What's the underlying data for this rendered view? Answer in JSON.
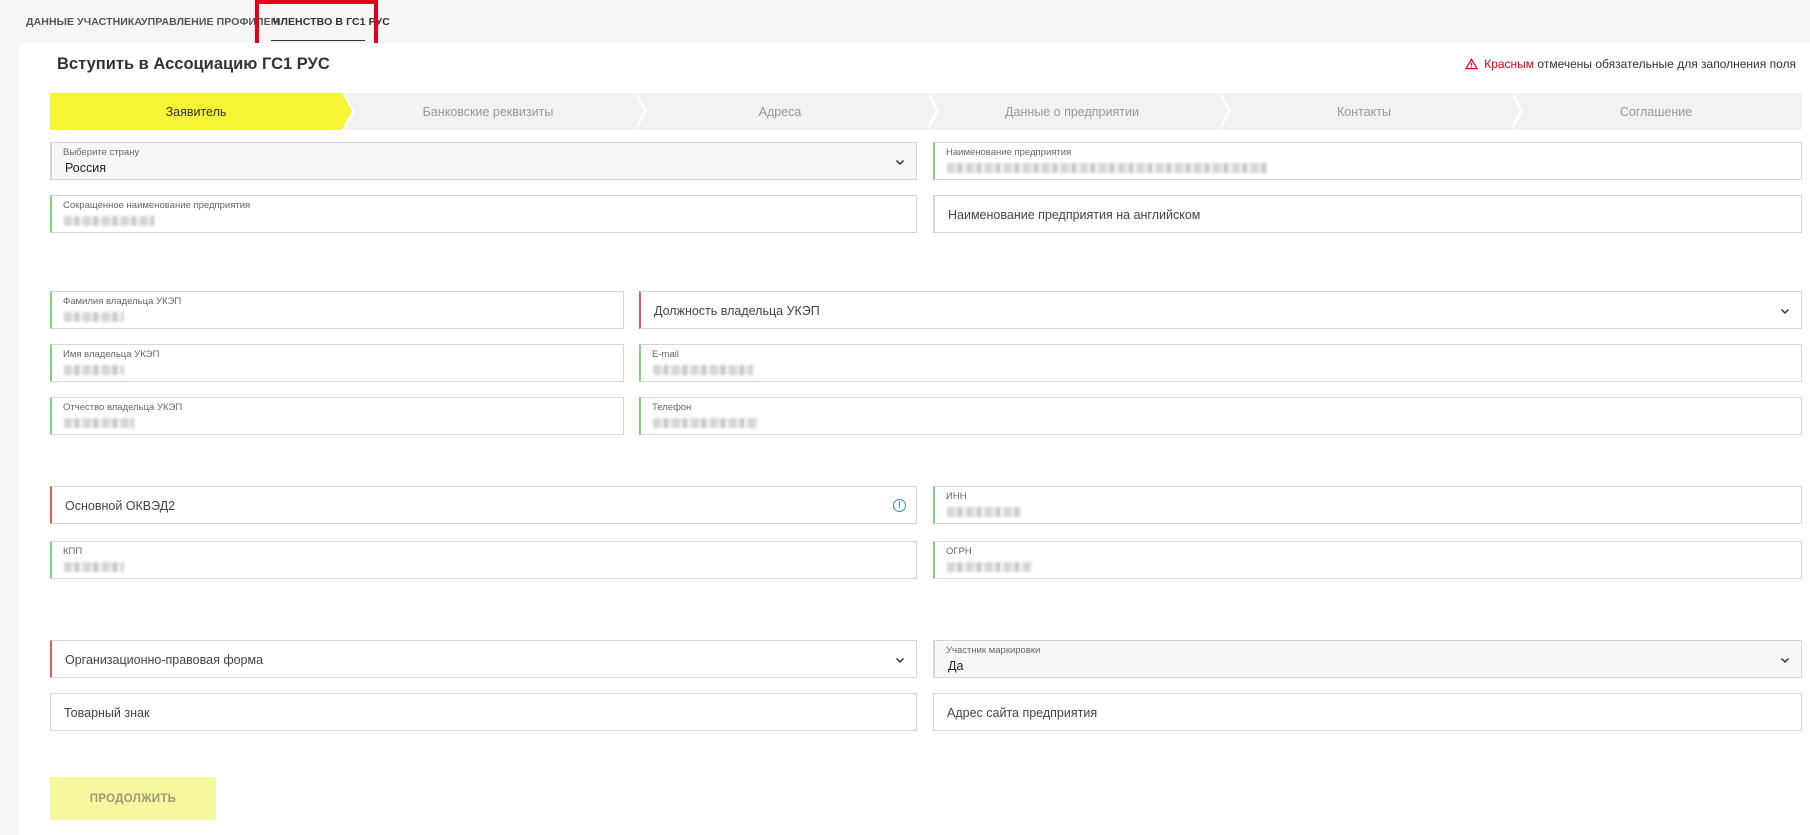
{
  "tabs": [
    {
      "label": "ДАННЫЕ УЧАСТНИКА"
    },
    {
      "label": "УПРАВЛЕНИЕ ПРОФИЛЕМ"
    },
    {
      "label": "ЧЛЕНСТВО В ГС1 РУС"
    }
  ],
  "page": {
    "title": "Вступить в Ассоциацию ГС1 РУС",
    "required_note_red": "Красным",
    "required_note_rest": "отмечены обязательные для заполнения поля"
  },
  "steps": [
    "Заявитель",
    "Банковские реквизиты",
    "Адреса",
    "Данные о предприятии",
    "Контакты",
    "Соглашение"
  ],
  "fields": {
    "country": {
      "label": "Выберите страну",
      "value": "Россия"
    },
    "company_name": {
      "label": "Наименование предприятия"
    },
    "short_name": {
      "label": "Сокращенное наименование предприятия"
    },
    "english_name": {
      "placeholder": "Наименование предприятия на английском"
    },
    "owner_last_name": {
      "label": "Фамилия владельца УКЭП"
    },
    "owner_position": {
      "placeholder": "Должность владельца УКЭП"
    },
    "owner_first_name": {
      "label": "Имя владельца УКЭП"
    },
    "email": {
      "label": "E-mail"
    },
    "owner_patronymic": {
      "label": "Отчество владельца УКЭП"
    },
    "phone": {
      "label": "Телефон"
    },
    "okved": {
      "placeholder": "Основной ОКВЭД2"
    },
    "inn": {
      "label": "ИНН"
    },
    "kpp": {
      "label": "КПП"
    },
    "ogrn": {
      "label": "ОГРН"
    },
    "legal_form": {
      "placeholder": "Организационно-правовая форма"
    },
    "marking_participant": {
      "label": "Участник маркировки",
      "value": "Да"
    },
    "trademark": {
      "placeholder": "Товарный знак"
    },
    "website": {
      "placeholder": "Адрес сайта предприятия"
    }
  },
  "actions": {
    "continue_label": "ПРОДОЛЖИТЬ"
  },
  "colors": {
    "accent_yellow": "#f5f533",
    "required_red": "#e85a5a",
    "valid_green": "#7ed37e",
    "highlight_red": "#e3001b"
  }
}
